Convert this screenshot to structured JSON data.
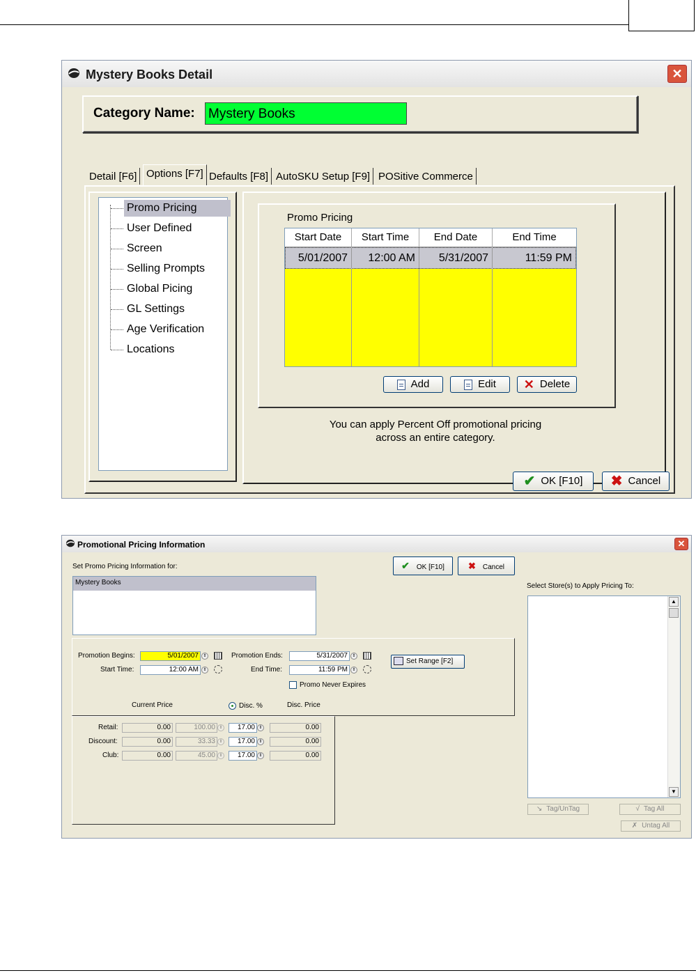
{
  "detail_window": {
    "title": "Mystery Books Detail",
    "close_glyph": "✕",
    "category_label": "Category Name:",
    "category_value": "Mystery Books",
    "tabs": [
      "Detail [F6]",
      "Options [F7]",
      "Defaults [F8]",
      "AutoSKU Setup [F9]",
      "POSitive Commerce"
    ],
    "active_tab": "Options [F7]",
    "tree_items": [
      "Promo Pricing",
      "User Defined",
      "Screen",
      "Selling Prompts",
      "Global Picing",
      "GL Settings",
      "Age Verification",
      "Locations"
    ],
    "group_label": "Promo Pricing",
    "grid_headers": [
      "Start Date",
      "Start Time",
      "End Date",
      "End Time"
    ],
    "grid_row": [
      "5/01/2007",
      "12:00 AM",
      "5/31/2007",
      "11:59 PM"
    ],
    "add_label": "Add",
    "edit_label": "Edit",
    "delete_label": "Delete",
    "help_line1": "You can apply Percent Off promotional pricing",
    "help_line2": "across an entire category.",
    "ok_label": "OK [F10]",
    "cancel_label": "Cancel",
    "highlight_color": "#00ff33",
    "grid_color": "#ffff00"
  },
  "promo_window": {
    "title": "Promotional Pricing Information",
    "set_for_label": "Set Promo Pricing Information for:",
    "list_item": "Mystery Books",
    "ok_label": "OK [F10]",
    "cancel_label": "Cancel",
    "stores_label": "Select Store(s) to Apply Pricing To:",
    "promo_begins_label": "Promotion Begins:",
    "promo_begins_value": "5/01/2007",
    "promo_ends_label": "Promotion Ends:",
    "promo_ends_value": "5/31/2007",
    "start_time_label": "Start Time:",
    "start_time_value": "12:00 AM",
    "end_time_label": "End Time:",
    "end_time_value": "11:59 PM",
    "set_range_label": "Set Range [F2]",
    "never_expires_label": "Promo Never Expires",
    "col_current_price": "Current Price",
    "col_disc_pct": "Disc. %",
    "col_disc_price": "Disc. Price",
    "rows": [
      {
        "label": "Retail:",
        "current": "0.00",
        "pct_disabled": "100.00",
        "disc": "17.00",
        "disc_price": "0.00"
      },
      {
        "label": "Discount:",
        "current": "0.00",
        "pct_disabled": "33.33",
        "disc": "17.00",
        "disc_price": "0.00"
      },
      {
        "label": "Club:",
        "current": "0.00",
        "pct_disabled": "45.00",
        "disc": "17.00",
        "disc_price": "0.00"
      }
    ],
    "tag_untag_label": "Tag/UnTag",
    "tag_all_label": "Tag All",
    "untag_all_label": "Untag All",
    "begin_highlight_color": "#ffff00"
  }
}
